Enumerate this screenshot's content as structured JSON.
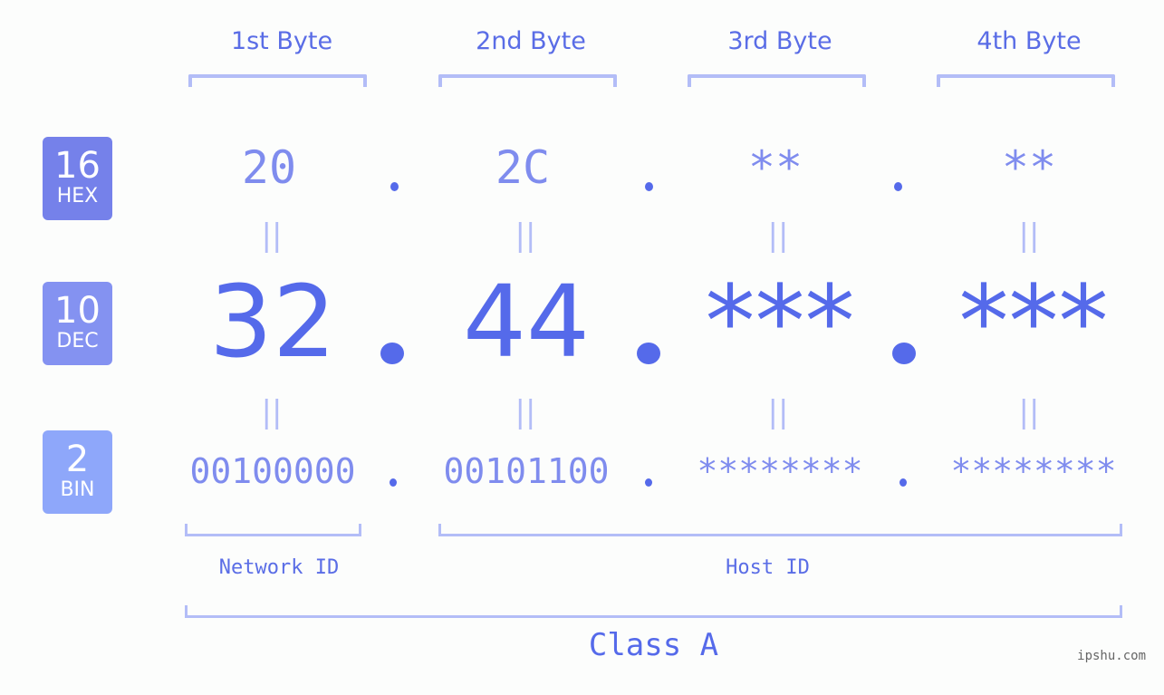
{
  "colors": {
    "accent": "#556aea",
    "light_accent": "#7f8cee",
    "bracket": "#b3bdf7",
    "hex_badge": "#7581ea",
    "dec_badge": "#8492f1",
    "bin_badge": "#8ea7fa"
  },
  "bytes": [
    {
      "header": "1st Byte",
      "hex": "20",
      "dec": "32",
      "bin": "00100000"
    },
    {
      "header": "2nd Byte",
      "hex": "2C",
      "dec": "44",
      "bin": "00101100"
    },
    {
      "header": "3rd Byte",
      "hex": "**",
      "dec": "***",
      "bin": "********"
    },
    {
      "header": "4th Byte",
      "hex": "**",
      "dec": "***",
      "bin": "********"
    }
  ],
  "badges": {
    "hex": {
      "num": "16",
      "label": "HEX"
    },
    "dec": {
      "num": "10",
      "label": "DEC"
    },
    "bin": {
      "num": "2",
      "label": "BIN"
    }
  },
  "equals_glyph": "||",
  "labels": {
    "network_id": "Network ID",
    "host_id": "Host ID",
    "class": "Class A"
  },
  "watermark": "ipshu.com"
}
